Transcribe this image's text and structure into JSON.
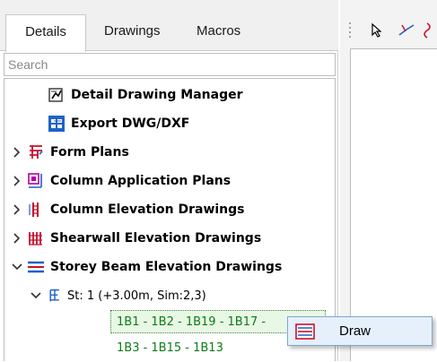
{
  "tabs": [
    {
      "label": "Details"
    },
    {
      "label": "Drawings"
    },
    {
      "label": "Macros"
    }
  ],
  "search": {
    "placeholder": "Search"
  },
  "tree": {
    "items": [
      {
        "label": "Detail Drawing Manager",
        "icon": "detail-drawing-manager-icon"
      },
      {
        "label": "Export DWG/DXF",
        "icon": "export-dwg-icon"
      },
      {
        "label": "Form Plans",
        "icon": "form-plans-icon",
        "expanded": false
      },
      {
        "label": "Column Application Plans",
        "icon": "column-application-icon",
        "expanded": false
      },
      {
        "label": "Column Elevation Drawings",
        "icon": "column-elevation-icon",
        "expanded": false
      },
      {
        "label": "Shearwall Elevation Drawings",
        "icon": "shearwall-elevation-icon",
        "expanded": false
      },
      {
        "label": "Storey Beam Elevation Drawings",
        "icon": "storey-beam-elevation-icon",
        "expanded": true
      }
    ],
    "storey": {
      "label": "St: 1 (+3.00m, Sim:2,3)",
      "icon": "storey-icon",
      "expanded": true
    },
    "leaves": [
      {
        "label": "1B1 - 1B2 - 1B19 - 1B17 -",
        "selected": true
      },
      {
        "label": "1B3 - 1B15 - 1B13",
        "selected": false
      }
    ]
  },
  "context_menu": {
    "items": [
      {
        "label": "Draw",
        "icon": "draw-icon"
      }
    ]
  },
  "colors": {
    "leaf_text": "#0a7d18",
    "menu_bg": "#e6f0fb",
    "menu_border": "#7ca6d8"
  }
}
